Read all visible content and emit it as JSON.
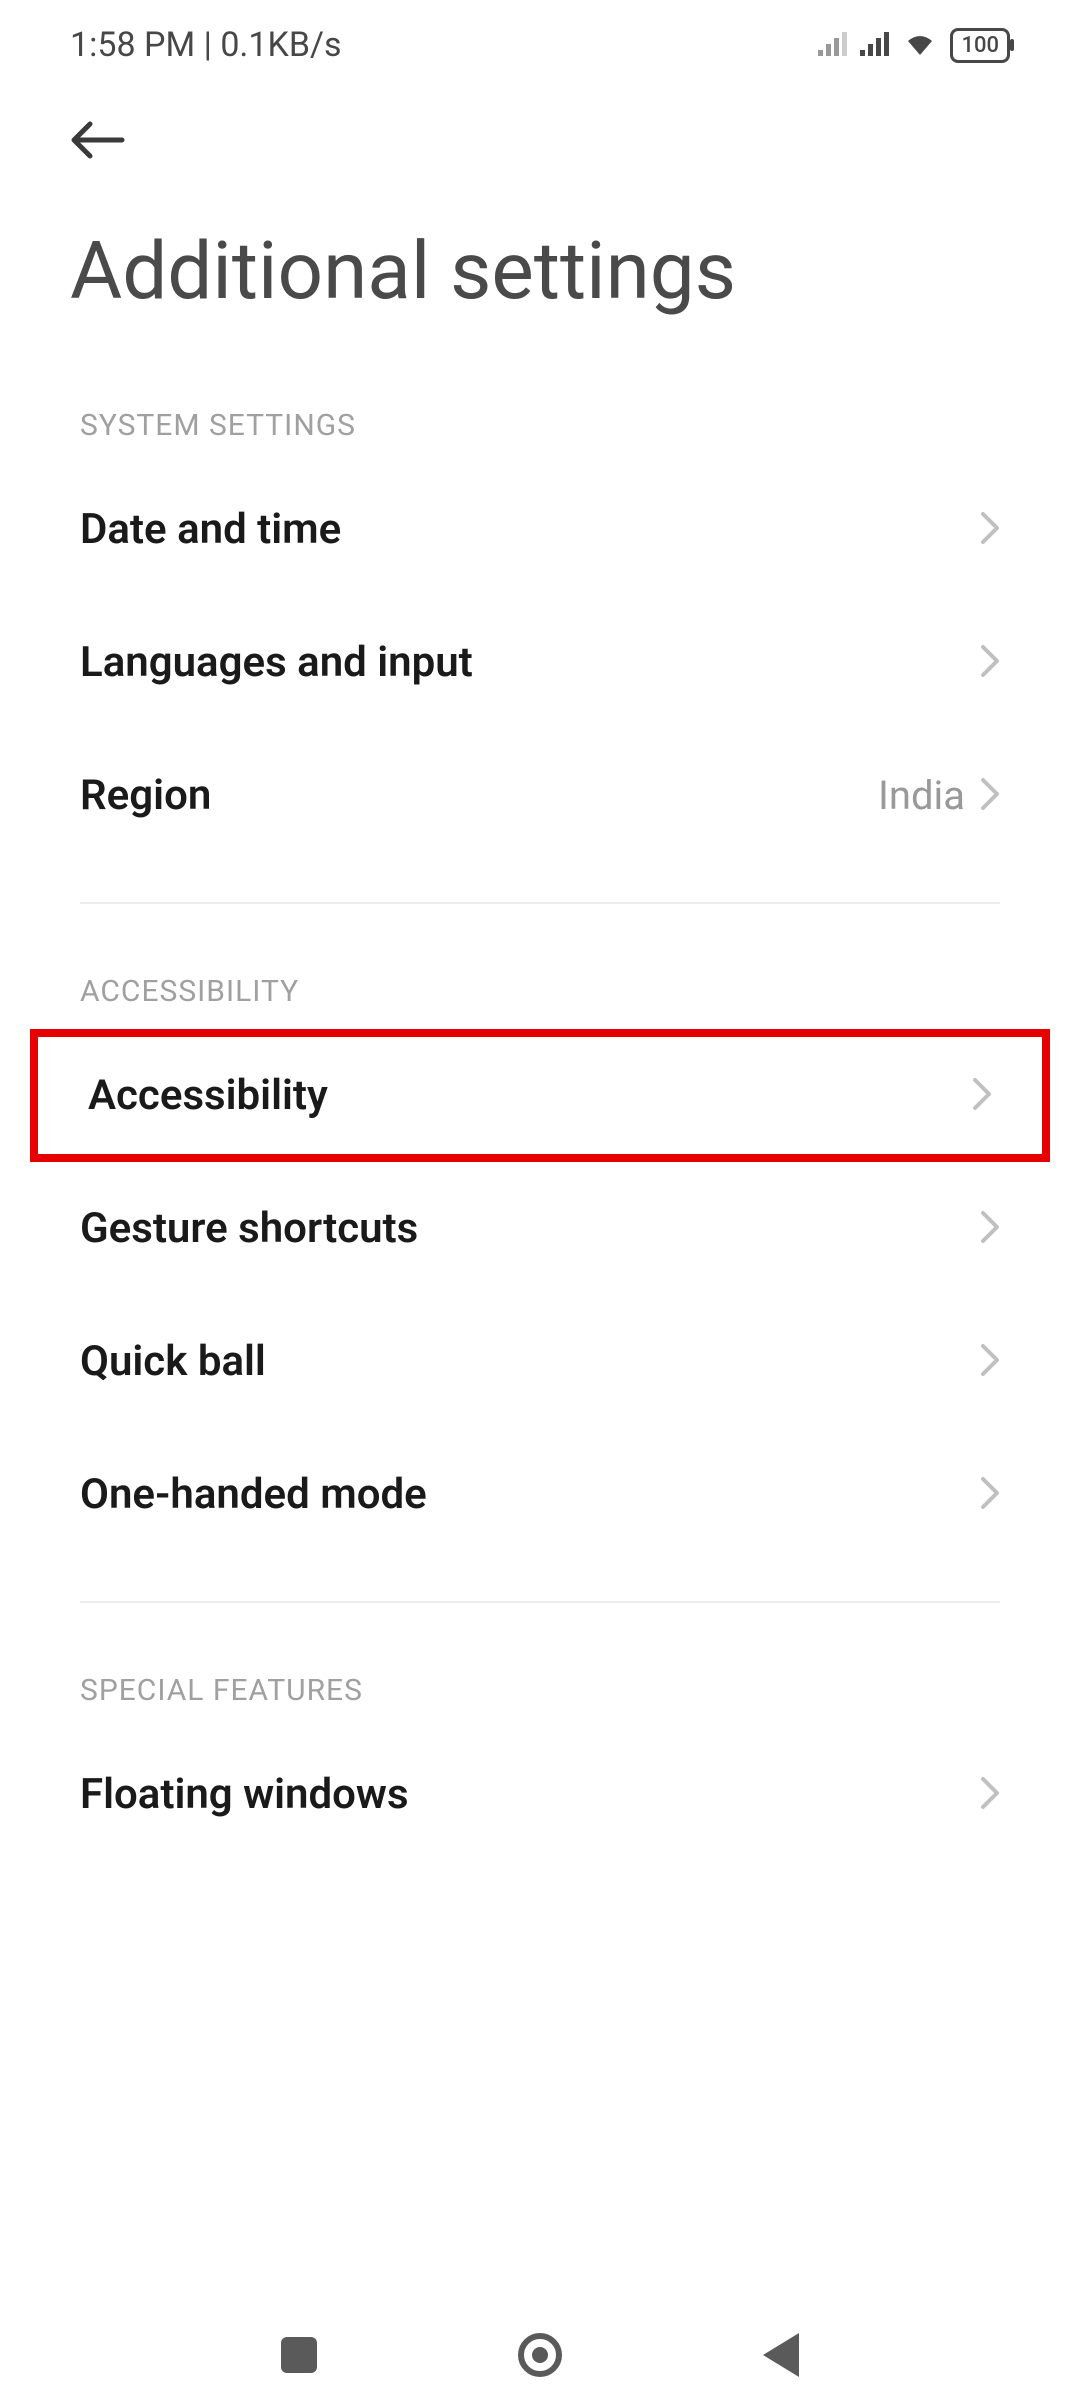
{
  "statusBar": {
    "time": "1:58 PM",
    "separator": " | ",
    "networkSpeed": "0.1KB/s",
    "batteryLevel": "100"
  },
  "pageTitle": "Additional settings",
  "sections": [
    {
      "header": "SYSTEM SETTINGS",
      "items": [
        {
          "label": "Date and time",
          "value": ""
        },
        {
          "label": "Languages and input",
          "value": ""
        },
        {
          "label": "Region",
          "value": "India"
        }
      ]
    },
    {
      "header": "ACCESSIBILITY",
      "items": [
        {
          "label": "Accessibility",
          "value": "",
          "highlighted": true
        },
        {
          "label": "Gesture shortcuts",
          "value": ""
        },
        {
          "label": "Quick ball",
          "value": ""
        },
        {
          "label": "One-handed mode",
          "value": ""
        }
      ]
    },
    {
      "header": "SPECIAL FEATURES",
      "items": [
        {
          "label": "Floating windows",
          "value": ""
        }
      ]
    }
  ],
  "highlightColor": "#e60000"
}
